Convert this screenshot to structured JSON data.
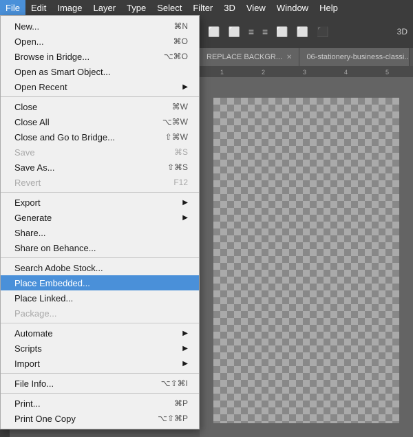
{
  "menubar": {
    "items": [
      {
        "label": "File",
        "active": true
      },
      {
        "label": "Edit",
        "active": false
      },
      {
        "label": "Image",
        "active": false
      },
      {
        "label": "Layer",
        "active": false
      },
      {
        "label": "Type",
        "active": false
      },
      {
        "label": "Select",
        "active": false
      },
      {
        "label": "Filter",
        "active": false
      },
      {
        "label": "3D",
        "active": false
      },
      {
        "label": "View",
        "active": false
      },
      {
        "label": "Window",
        "active": false
      },
      {
        "label": "Help",
        "active": false
      }
    ]
  },
  "file_menu": {
    "sections": [
      {
        "items": [
          {
            "label": "New...",
            "shortcut": "⌘N",
            "disabled": false,
            "has_arrow": false
          },
          {
            "label": "Open...",
            "shortcut": "⌘O",
            "disabled": false,
            "has_arrow": false
          },
          {
            "label": "Browse in Bridge...",
            "shortcut": "⌥⌘O",
            "disabled": false,
            "has_arrow": false
          },
          {
            "label": "Open as Smart Object...",
            "shortcut": "",
            "disabled": false,
            "has_arrow": false
          },
          {
            "label": "Open Recent",
            "shortcut": "",
            "disabled": false,
            "has_arrow": true
          }
        ]
      },
      {
        "items": [
          {
            "label": "Close",
            "shortcut": "⌘W",
            "disabled": false,
            "has_arrow": false
          },
          {
            "label": "Close All",
            "shortcut": "⌥⌘W",
            "disabled": false,
            "has_arrow": false
          },
          {
            "label": "Close and Go to Bridge...",
            "shortcut": "⇧⌘W",
            "disabled": false,
            "has_arrow": false
          },
          {
            "label": "Save",
            "shortcut": "⌘S",
            "disabled": true,
            "has_arrow": false
          },
          {
            "label": "Save As...",
            "shortcut": "⇧⌘S",
            "disabled": false,
            "has_arrow": false
          },
          {
            "label": "Revert",
            "shortcut": "F12",
            "disabled": true,
            "has_arrow": false
          }
        ]
      },
      {
        "items": [
          {
            "label": "Export",
            "shortcut": "",
            "disabled": false,
            "has_arrow": true
          },
          {
            "label": "Generate",
            "shortcut": "",
            "disabled": false,
            "has_arrow": true
          },
          {
            "label": "Share...",
            "shortcut": "",
            "disabled": false,
            "has_arrow": false
          },
          {
            "label": "Share on Behance...",
            "shortcut": "",
            "disabled": false,
            "has_arrow": false
          }
        ]
      },
      {
        "items": [
          {
            "label": "Search Adobe Stock...",
            "shortcut": "",
            "disabled": false,
            "has_arrow": false
          },
          {
            "label": "Place Embedded...",
            "shortcut": "",
            "disabled": false,
            "has_arrow": false,
            "highlighted": true
          },
          {
            "label": "Place Linked...",
            "shortcut": "",
            "disabled": false,
            "has_arrow": false
          },
          {
            "label": "Package...",
            "shortcut": "",
            "disabled": true,
            "has_arrow": false
          }
        ]
      },
      {
        "items": [
          {
            "label": "Automate",
            "shortcut": "",
            "disabled": false,
            "has_arrow": true
          },
          {
            "label": "Scripts",
            "shortcut": "",
            "disabled": false,
            "has_arrow": true
          },
          {
            "label": "Import",
            "shortcut": "",
            "disabled": false,
            "has_arrow": true
          }
        ]
      },
      {
        "items": [
          {
            "label": "File Info...",
            "shortcut": "⌥⇧⌘I",
            "disabled": false,
            "has_arrow": false
          }
        ]
      },
      {
        "items": [
          {
            "label": "Print...",
            "shortcut": "⌘P",
            "disabled": false,
            "has_arrow": false
          },
          {
            "label": "Print One Copy",
            "shortcut": "⌥⇧⌘P",
            "disabled": false,
            "has_arrow": false
          }
        ]
      }
    ]
  },
  "tabs": [
    {
      "label": "REPLACE BACKGR...",
      "closeable": true
    },
    {
      "label": "06-stationery-business-classi...",
      "closeable": true
    }
  ],
  "ruler": {
    "ticks": [
      "1",
      "2",
      "3",
      "4",
      "5"
    ]
  }
}
